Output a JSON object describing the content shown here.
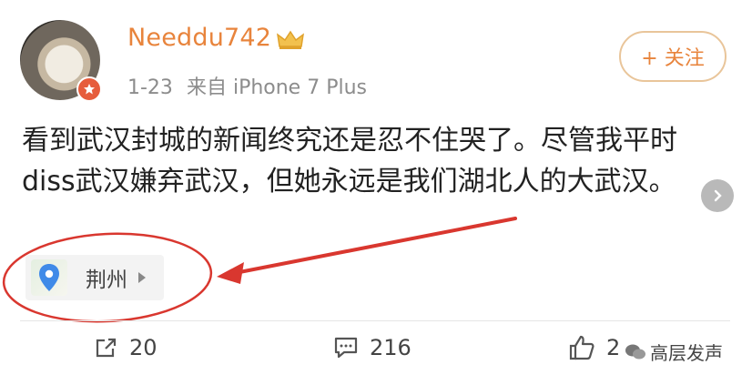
{
  "post": {
    "username": "Needdu742",
    "date": "1-23",
    "source_prefix": "来自",
    "device": "iPhone 7 Plus",
    "follow_label": "+ 关注",
    "text": "看到武汉封城的新闻终究还是忍不住哭了。尽管我平时diss武汉嫌弃武汉，但她永远是我们湖北人的大武汉。",
    "location": "荆州"
  },
  "actions": {
    "reposts": "20",
    "comments": "216",
    "likes": "2"
  },
  "watermark": {
    "text": "高层发声"
  },
  "colors": {
    "username": "#e8843c",
    "annotation": "#d9372f",
    "follow_border": "#e9c59a",
    "meta": "#8c8c8c"
  },
  "icons": {
    "crown": "crown-icon",
    "verified": "verified-badge-icon",
    "location": "location-pin-icon",
    "repost": "repost-icon",
    "comment": "comment-icon",
    "like": "like-icon",
    "next": "chevron-right-icon"
  }
}
